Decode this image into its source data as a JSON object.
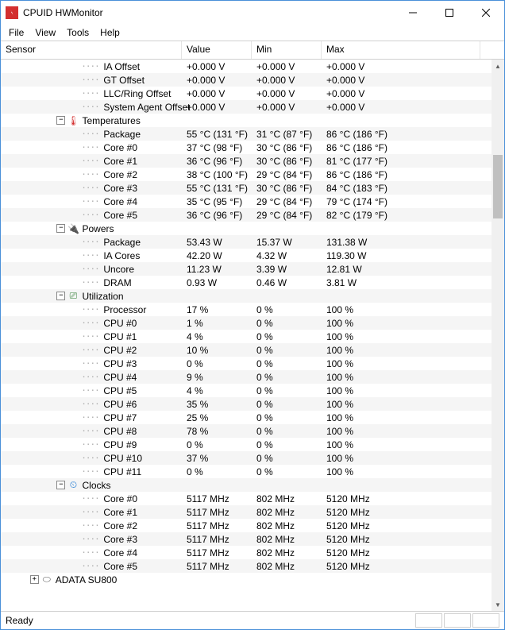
{
  "window": {
    "title": "CPUID HWMonitor"
  },
  "menu": [
    "File",
    "View",
    "Tools",
    "Help"
  ],
  "columns": {
    "sensor": "Sensor",
    "value": "Value",
    "min": "Min",
    "max": "Max"
  },
  "status": "Ready",
  "icons": {
    "temp": "🌡",
    "power": "🔌",
    "util": "⎚",
    "clocks": "⏲",
    "disk": "⬭"
  },
  "rows": [
    {
      "indent": 4,
      "label": "IA Offset",
      "value": "+0.000 V",
      "min": "+0.000 V",
      "max": "+0.000 V"
    },
    {
      "indent": 4,
      "label": "GT Offset",
      "value": "+0.000 V",
      "min": "+0.000 V",
      "max": "+0.000 V"
    },
    {
      "indent": 4,
      "label": "LLC/Ring Offset",
      "value": "+0.000 V",
      "min": "+0.000 V",
      "max": "+0.000 V"
    },
    {
      "indent": 4,
      "label": "System Agent Offset",
      "value": "+0.000 V",
      "min": "+0.000 V",
      "max": "+0.000 V"
    },
    {
      "indent": 2,
      "section": true,
      "expanded": true,
      "icon": "temp",
      "label": "Temperatures"
    },
    {
      "indent": 4,
      "label": "Package",
      "value": "55 °C  (131 °F)",
      "min": "31 °C   (87 °F)",
      "max": "86 °C  (186 °F)"
    },
    {
      "indent": 4,
      "label": "Core #0",
      "value": "37 °C   (98 °F)",
      "min": "30 °C   (86 °F)",
      "max": "86 °C  (186 °F)"
    },
    {
      "indent": 4,
      "label": "Core #1",
      "value": "36 °C   (96 °F)",
      "min": "30 °C   (86 °F)",
      "max": "81 °C  (177 °F)"
    },
    {
      "indent": 4,
      "label": "Core #2",
      "value": "38 °C  (100 °F)",
      "min": "29 °C   (84 °F)",
      "max": "86 °C  (186 °F)"
    },
    {
      "indent": 4,
      "label": "Core #3",
      "value": "55 °C  (131 °F)",
      "min": "30 °C   (86 °F)",
      "max": "84 °C  (183 °F)"
    },
    {
      "indent": 4,
      "label": "Core #4",
      "value": "35 °C   (95 °F)",
      "min": "29 °C   (84 °F)",
      "max": "79 °C  (174 °F)"
    },
    {
      "indent": 4,
      "label": "Core #5",
      "value": "36 °C   (96 °F)",
      "min": "29 °C   (84 °F)",
      "max": "82 °C  (179 °F)"
    },
    {
      "indent": 2,
      "section": true,
      "expanded": true,
      "icon": "power",
      "label": "Powers"
    },
    {
      "indent": 4,
      "label": "Package",
      "value": "53.43 W",
      "min": "15.37 W",
      "max": "131.38 W"
    },
    {
      "indent": 4,
      "label": "IA Cores",
      "value": "42.20 W",
      "min": "4.32 W",
      "max": "119.30 W"
    },
    {
      "indent": 4,
      "label": "Uncore",
      "value": "11.23 W",
      "min": "3.39 W",
      "max": "12.81 W"
    },
    {
      "indent": 4,
      "label": "DRAM",
      "value": "0.93 W",
      "min": "0.46 W",
      "max": "3.81 W"
    },
    {
      "indent": 2,
      "section": true,
      "expanded": true,
      "icon": "util",
      "label": "Utilization"
    },
    {
      "indent": 4,
      "label": "Processor",
      "value": "17 %",
      "min": "0 %",
      "max": "100 %"
    },
    {
      "indent": 4,
      "label": "CPU #0",
      "value": "1 %",
      "min": "0 %",
      "max": "100 %"
    },
    {
      "indent": 4,
      "label": "CPU #1",
      "value": "4 %",
      "min": "0 %",
      "max": "100 %"
    },
    {
      "indent": 4,
      "label": "CPU #2",
      "value": "10 %",
      "min": "0 %",
      "max": "100 %"
    },
    {
      "indent": 4,
      "label": "CPU #3",
      "value": "0 %",
      "min": "0 %",
      "max": "100 %"
    },
    {
      "indent": 4,
      "label": "CPU #4",
      "value": "9 %",
      "min": "0 %",
      "max": "100 %"
    },
    {
      "indent": 4,
      "label": "CPU #5",
      "value": "4 %",
      "min": "0 %",
      "max": "100 %"
    },
    {
      "indent": 4,
      "label": "CPU #6",
      "value": "35 %",
      "min": "0 %",
      "max": "100 %"
    },
    {
      "indent": 4,
      "label": "CPU #7",
      "value": "25 %",
      "min": "0 %",
      "max": "100 %"
    },
    {
      "indent": 4,
      "label": "CPU #8",
      "value": "78 %",
      "min": "0 %",
      "max": "100 %"
    },
    {
      "indent": 4,
      "label": "CPU #9",
      "value": "0 %",
      "min": "0 %",
      "max": "100 %"
    },
    {
      "indent": 4,
      "label": "CPU #10",
      "value": "37 %",
      "min": "0 %",
      "max": "100 %"
    },
    {
      "indent": 4,
      "label": "CPU #11",
      "value": "0 %",
      "min": "0 %",
      "max": "100 %"
    },
    {
      "indent": 2,
      "section": true,
      "expanded": true,
      "icon": "clocks",
      "label": "Clocks"
    },
    {
      "indent": 4,
      "label": "Core #0",
      "value": "5117 MHz",
      "min": "802 MHz",
      "max": "5120 MHz"
    },
    {
      "indent": 4,
      "label": "Core #1",
      "value": "5117 MHz",
      "min": "802 MHz",
      "max": "5120 MHz"
    },
    {
      "indent": 4,
      "label": "Core #2",
      "value": "5117 MHz",
      "min": "802 MHz",
      "max": "5120 MHz"
    },
    {
      "indent": 4,
      "label": "Core #3",
      "value": "5117 MHz",
      "min": "802 MHz",
      "max": "5120 MHz"
    },
    {
      "indent": 4,
      "label": "Core #4",
      "value": "5117 MHz",
      "min": "802 MHz",
      "max": "5120 MHz"
    },
    {
      "indent": 4,
      "label": "Core #5",
      "value": "5117 MHz",
      "min": "802 MHz",
      "max": "5120 MHz"
    },
    {
      "indent": 1,
      "section": true,
      "expanded": false,
      "icon": "disk",
      "label": "ADATA SU800"
    }
  ]
}
